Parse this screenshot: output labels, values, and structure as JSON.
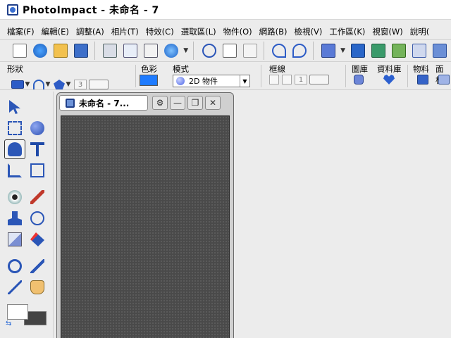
{
  "window": {
    "title": "PhotoImpact - 未命名 - 7"
  },
  "menu": {
    "items": [
      "檔案(F)",
      "編輯(E)",
      "調整(A)",
      "相片(T)",
      "特效(C)",
      "選取區(L)",
      "物件(O)",
      "網路(B)",
      "檢視(V)",
      "工作區(K)",
      "視窗(W)",
      "說明("
    ]
  },
  "toolbar": {
    "buttons": [
      "new-icon",
      "web-icon",
      "open-icon",
      "save-icon",
      "print-icon",
      "print-multiple-icon",
      "print-preview-icon",
      "browser-icon",
      "cut-icon",
      "copy-icon",
      "paste-icon",
      "undo-icon",
      "redo-icon",
      "scanner-icon",
      "camera-icon",
      "screen-capture-icon",
      "image-icon",
      "chart-icon",
      "gallery-icon"
    ]
  },
  "attributes": {
    "shape_label": "形狀",
    "color_label": "色彩",
    "mode_label": "模式",
    "mode_value": "2D 物件",
    "border_label": "框線",
    "border_value": "1",
    "shape_spin_value": "3",
    "library_label": "圖庫",
    "data_library_label": "資料庫",
    "material_label": "物料",
    "panel_label": "面板",
    "accent_color": "#1e7bff"
  },
  "doc": {
    "title": "未命名 - 7..."
  }
}
